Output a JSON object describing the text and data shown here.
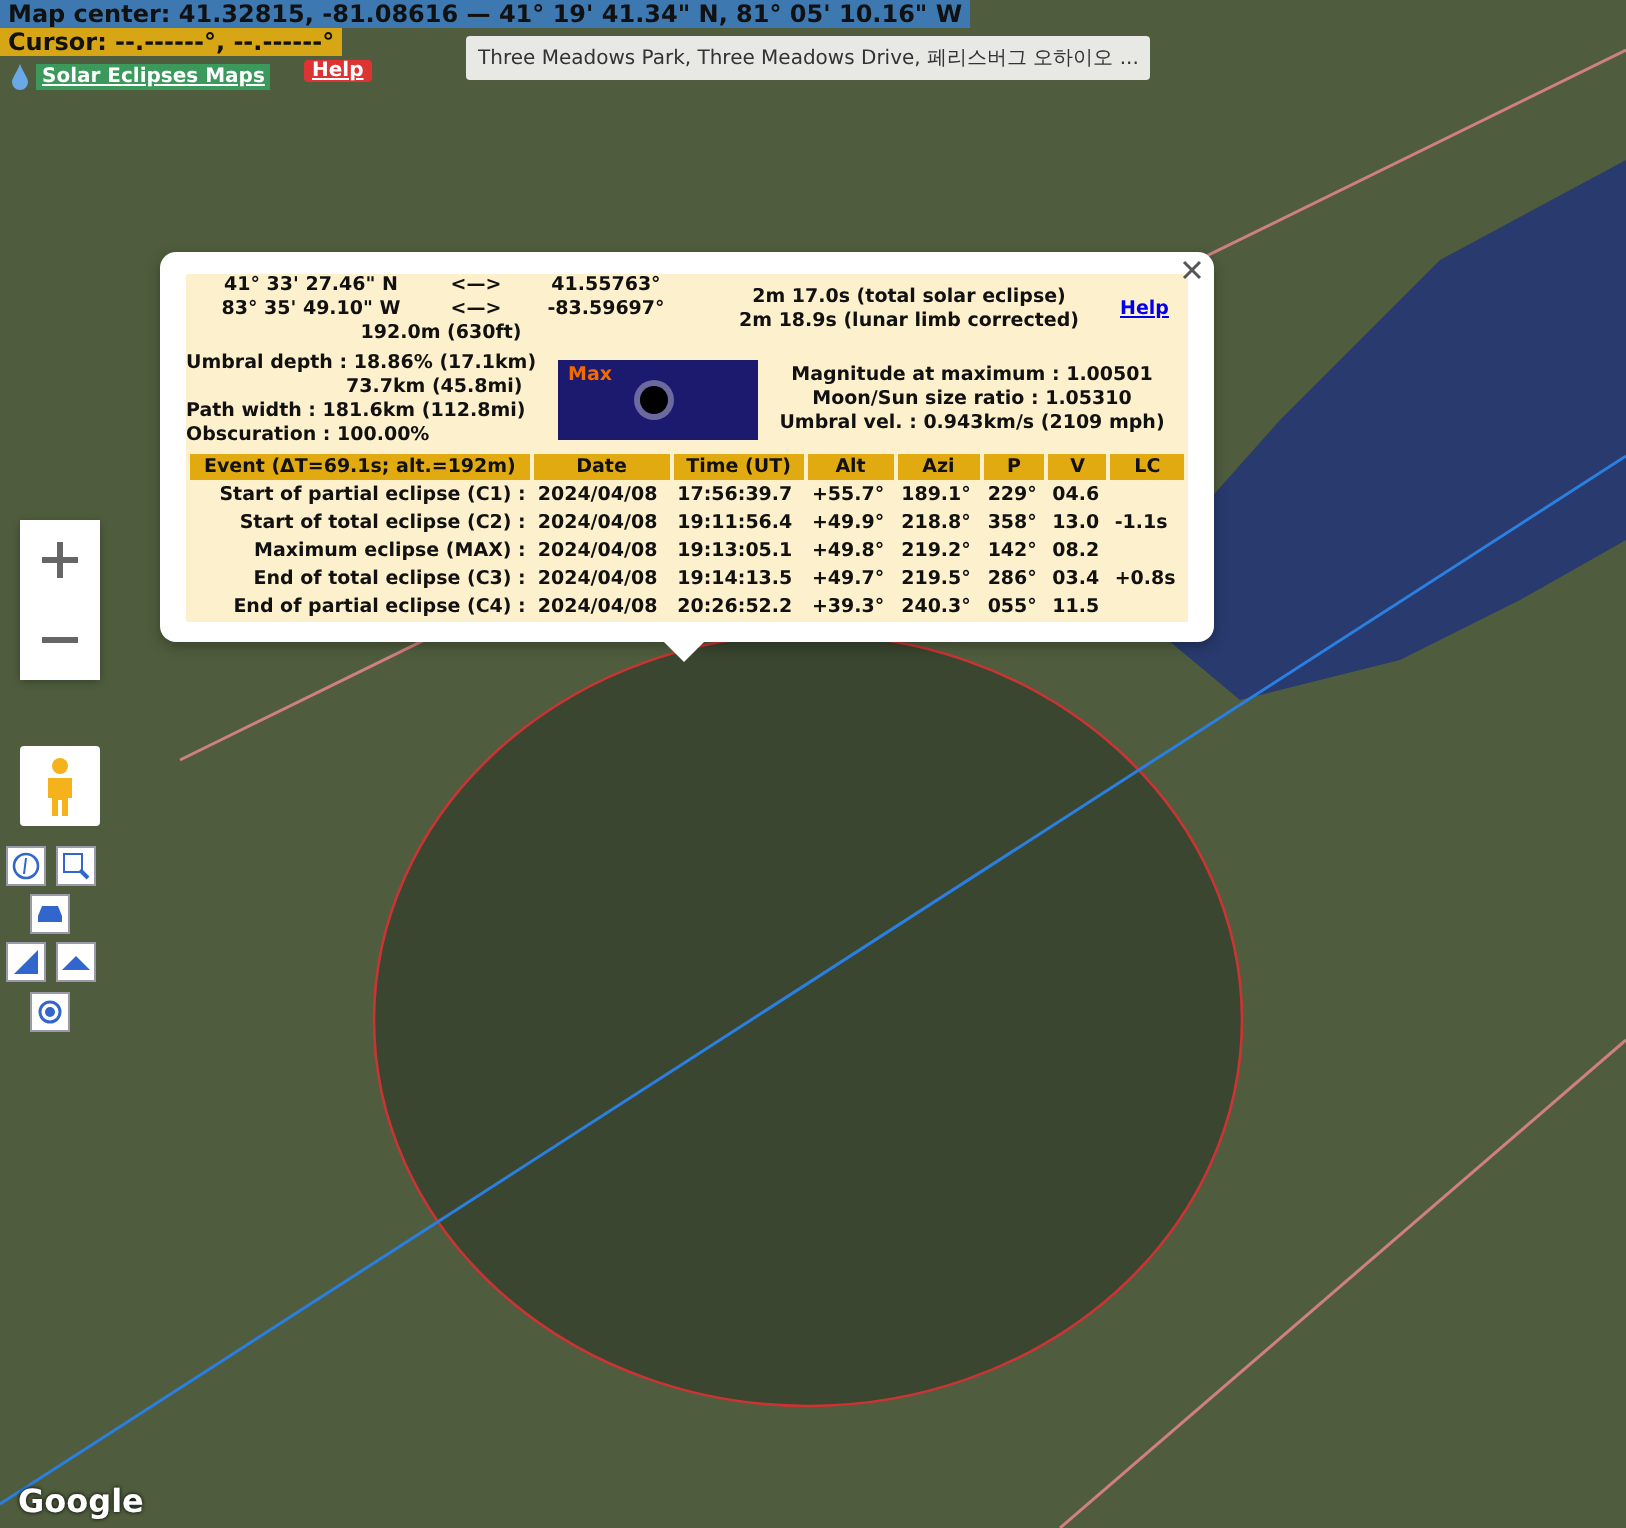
{
  "header": {
    "map_center": "Map center: 41.32815, -81.08616 — 41° 19' 41.34\" N, 81° 05' 10.16\" W",
    "cursor": "Cursor: --.------°, --.------°",
    "site_link": "Solar Eclipses Maps",
    "help": "Help"
  },
  "place_tooltip": "Three Meadows Park, Three Meadows Drive, 페리스버그 오하이오 ...",
  "popup": {
    "coords": [
      {
        "dms": "41° 33' 27.46\" N",
        "arrow": "<—>",
        "decimal": "41.55763°"
      },
      {
        "dms": "83° 35' 49.10\" W",
        "arrow": "<—>",
        "decimal": "-83.59697°"
      }
    ],
    "elevation": "192.0m (630ft)",
    "durations": [
      "2m 17.0s (total solar eclipse)",
      "2m 18.9s (lunar limb corrected)"
    ],
    "help": "Help",
    "umbra": [
      "Umbral depth : 18.86% (17.1km)",
      "73.7km (45.8mi)",
      "Path width : 181.6km (112.8mi)",
      "Obscuration : 100.00%"
    ],
    "eclipse_image_label": "Max",
    "magnitude": [
      "Magnitude at maximum : 1.00501",
      "Moon/Sun size ratio : 1.05310",
      "Umbral vel. : 0.943km/s (2109 mph)"
    ],
    "table": {
      "columns": [
        "Event (ΔT=69.1s; alt.=192m)",
        "Date",
        "Time (UT)",
        "Alt",
        "Azi",
        "P",
        "V",
        "LC"
      ],
      "rows": [
        [
          "Start of partial eclipse (C1) :",
          "2024/04/08",
          "17:56:39.7",
          "+55.7°",
          "189.1°",
          "229°",
          "04.6",
          ""
        ],
        [
          "Start of total eclipse (C2) :",
          "2024/04/08",
          "19:11:56.4",
          "+49.9°",
          "218.8°",
          "358°",
          "13.0",
          "-1.1s"
        ],
        [
          "Maximum eclipse (MAX) :",
          "2024/04/08",
          "19:13:05.1",
          "+49.8°",
          "219.2°",
          "142°",
          "08.2",
          ""
        ],
        [
          "End of total eclipse (C3) :",
          "2024/04/08",
          "19:14:13.5",
          "+49.7°",
          "219.5°",
          "286°",
          "03.4",
          "+0.8s"
        ],
        [
          "End of partial eclipse (C4) :",
          "2024/04/08",
          "20:26:52.2",
          "+39.3°",
          "240.3°",
          "055°",
          "11.5",
          ""
        ]
      ]
    }
  },
  "map_logo": "Google"
}
